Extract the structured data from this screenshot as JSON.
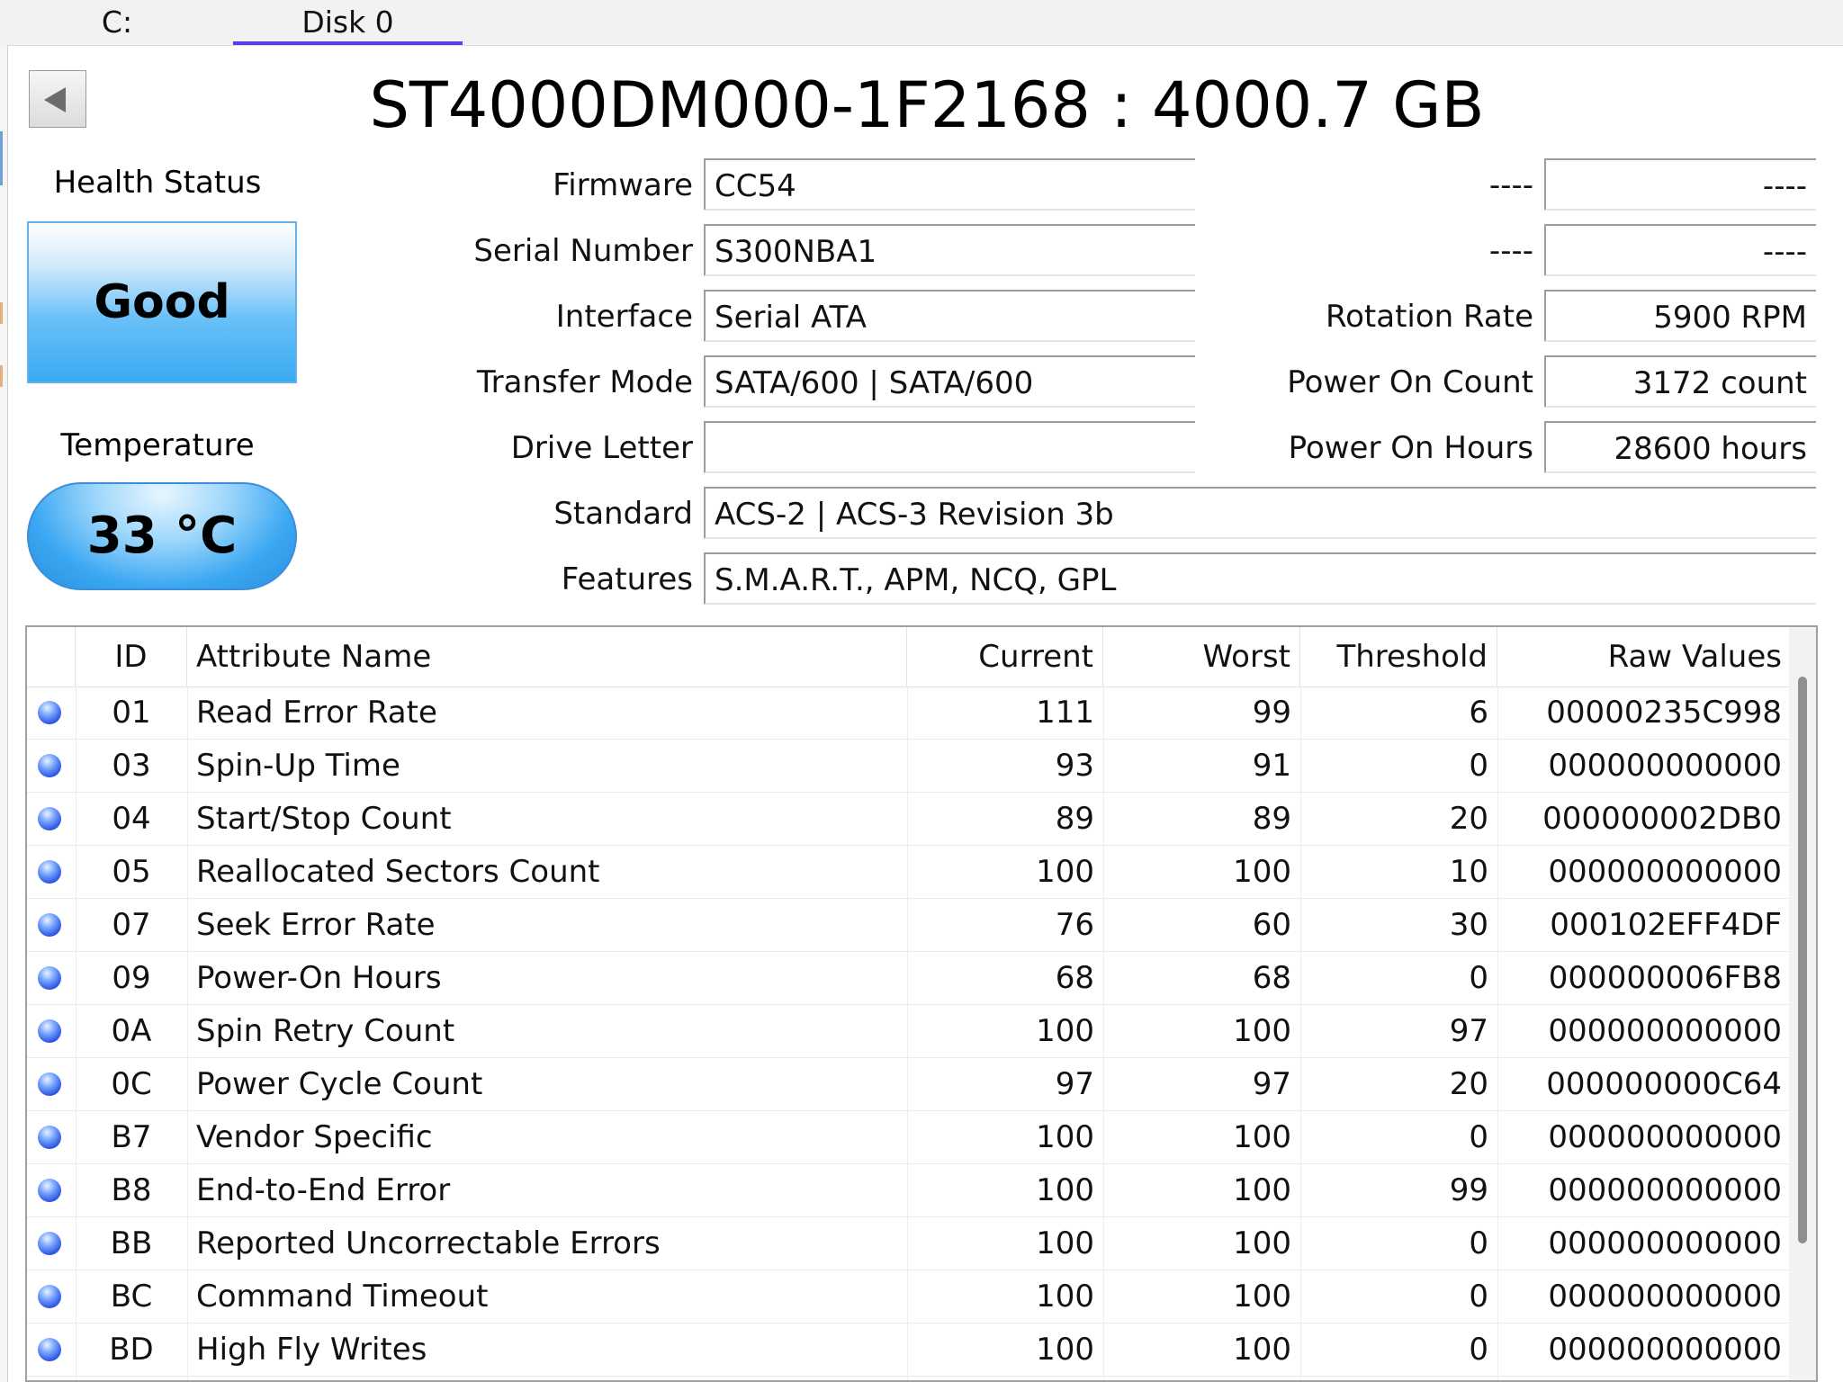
{
  "tabs": [
    {
      "label": "C:"
    },
    {
      "label": "Disk 0",
      "active": true
    }
  ],
  "title": "ST4000DM000-1F2168 : 4000.7 GB",
  "health": {
    "label": "Health Status",
    "value": "Good"
  },
  "temperature": {
    "label": "Temperature",
    "value": "33 °C"
  },
  "info_left": [
    {
      "label": "Firmware",
      "value": "CC54"
    },
    {
      "label": "Serial Number",
      "value": "S300NBA1"
    },
    {
      "label": "Interface",
      "value": "Serial ATA"
    },
    {
      "label": "Transfer Mode",
      "value": "SATA/600 | SATA/600"
    },
    {
      "label": "Drive Letter",
      "value": ""
    }
  ],
  "info_right": [
    {
      "label": "----",
      "value": "----"
    },
    {
      "label": "----",
      "value": "----"
    },
    {
      "label": "Rotation Rate",
      "value": "5900 RPM"
    },
    {
      "label": "Power On Count",
      "value": "3172 count"
    },
    {
      "label": "Power On Hours",
      "value": "28600 hours"
    }
  ],
  "info_wide": [
    {
      "label": "Standard",
      "value": "ACS-2 | ACS-3 Revision 3b"
    },
    {
      "label": "Features",
      "value": "S.M.A.R.T., APM, NCQ, GPL"
    }
  ],
  "smart": {
    "headers": {
      "id": "ID",
      "name": "Attribute Name",
      "current": "Current",
      "worst": "Worst",
      "threshold": "Threshold",
      "raw": "Raw Values"
    },
    "status_color": "#2a52e0",
    "rows": [
      {
        "id": "01",
        "name": "Read Error Rate",
        "current": "111",
        "worst": "99",
        "threshold": "6",
        "raw": "00000235C998"
      },
      {
        "id": "03",
        "name": "Spin-Up Time",
        "current": "93",
        "worst": "91",
        "threshold": "0",
        "raw": "000000000000"
      },
      {
        "id": "04",
        "name": "Start/Stop Count",
        "current": "89",
        "worst": "89",
        "threshold": "20",
        "raw": "000000002DB0"
      },
      {
        "id": "05",
        "name": "Reallocated Sectors Count",
        "current": "100",
        "worst": "100",
        "threshold": "10",
        "raw": "000000000000"
      },
      {
        "id": "07",
        "name": "Seek Error Rate",
        "current": "76",
        "worst": "60",
        "threshold": "30",
        "raw": "000102EFF4DF"
      },
      {
        "id": "09",
        "name": "Power-On Hours",
        "current": "68",
        "worst": "68",
        "threshold": "0",
        "raw": "000000006FB8"
      },
      {
        "id": "0A",
        "name": "Spin Retry Count",
        "current": "100",
        "worst": "100",
        "threshold": "97",
        "raw": "000000000000"
      },
      {
        "id": "0C",
        "name": "Power Cycle Count",
        "current": "97",
        "worst": "97",
        "threshold": "20",
        "raw": "000000000C64"
      },
      {
        "id": "B7",
        "name": "Vendor Specific",
        "current": "100",
        "worst": "100",
        "threshold": "0",
        "raw": "000000000000"
      },
      {
        "id": "B8",
        "name": "End-to-End Error",
        "current": "100",
        "worst": "100",
        "threshold": "99",
        "raw": "000000000000"
      },
      {
        "id": "BB",
        "name": "Reported Uncorrectable Errors",
        "current": "100",
        "worst": "100",
        "threshold": "0",
        "raw": "000000000000"
      },
      {
        "id": "BC",
        "name": "Command Timeout",
        "current": "100",
        "worst": "100",
        "threshold": "0",
        "raw": "000000000000"
      },
      {
        "id": "BD",
        "name": "High Fly Writes",
        "current": "100",
        "worst": "100",
        "threshold": "0",
        "raw": "000000000000"
      }
    ]
  },
  "icons": {
    "back": "back-arrow-icon",
    "status": "status-dot-icon"
  }
}
